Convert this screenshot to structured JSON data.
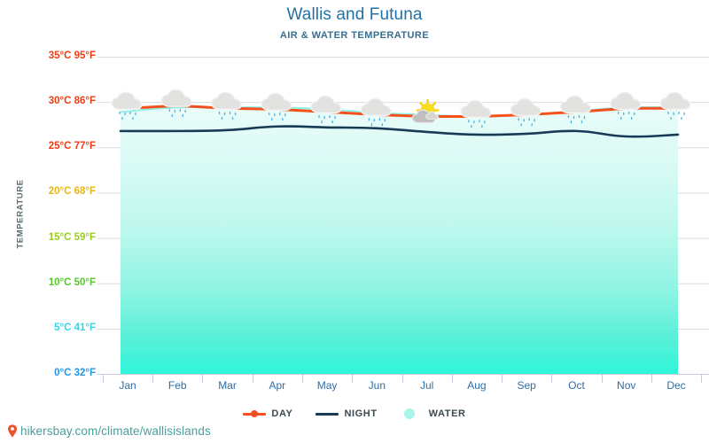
{
  "header": {
    "title": "Wallis and Futuna",
    "subtitle": "AIR & WATER TEMPERATURE"
  },
  "axis": {
    "y_title": "TEMPERATURE"
  },
  "legend": {
    "items": [
      {
        "label": "DAY",
        "type": "line-marker",
        "color": "#F4511E"
      },
      {
        "label": "NIGHT",
        "type": "line",
        "color": "#173A56"
      },
      {
        "label": "WATER",
        "type": "circle",
        "color": "#A8F5EA"
      }
    ]
  },
  "footer": {
    "icon": "map-pin-icon",
    "text": "hikersbay.com/climate/wallisislands",
    "color": "#4a9e9a",
    "pin_color": "#E8542A"
  },
  "weather_icons": [
    "rain-cloud-icon",
    "rain-cloud-icon",
    "rain-cloud-icon",
    "rain-cloud-icon",
    "rain-cloud-icon",
    "rain-cloud-icon",
    "sun-behind-cloud-icon",
    "rain-cloud-icon",
    "rain-cloud-icon",
    "rain-cloud-icon",
    "rain-cloud-icon",
    "rain-cloud-icon"
  ],
  "chart_data": {
    "type": "line",
    "title": "Wallis and Futuna",
    "subtitle": "AIR & WATER TEMPERATURE",
    "xlabel": "",
    "ylabel": "TEMPERATURE",
    "categories": [
      "Jan",
      "Feb",
      "Mar",
      "Apr",
      "May",
      "Jun",
      "Jul",
      "Aug",
      "Sep",
      "Oct",
      "Nov",
      "Dec"
    ],
    "ylim": [
      0,
      35
    ],
    "yticks": [
      0,
      5,
      10,
      15,
      20,
      25,
      30,
      35
    ],
    "ytick_labels": [
      "0°C 32°F",
      "5°C 41°F",
      "10°C 50°F",
      "15°C 59°F",
      "20°C 68°F",
      "25°C 77°F",
      "30°C 86°F",
      "35°C 95°F"
    ],
    "ytick_colors": [
      "#2196E3",
      "#35D6E6",
      "#55C82A",
      "#9ACD1E",
      "#E8B711",
      "#F03C11",
      "#F03C11",
      "#F03C11"
    ],
    "grid": true,
    "legend_position": "bottom",
    "series": [
      {
        "name": "DAY",
        "color": "#F4511E",
        "values": [
          29.3,
          29.6,
          29.3,
          29.2,
          28.9,
          28.6,
          28.4,
          28.4,
          28.6,
          28.9,
          29.3,
          29.3
        ]
      },
      {
        "name": "NIGHT",
        "color": "#173A56",
        "values": [
          26.8,
          26.8,
          26.9,
          27.3,
          27.2,
          27.1,
          26.7,
          26.4,
          26.5,
          26.8,
          26.2,
          26.4
        ]
      },
      {
        "name": "WATER",
        "color": "#8FF0E4",
        "fill": true,
        "values": [
          28.9,
          29.4,
          29.4,
          29.4,
          29.2,
          28.8,
          28.6,
          28.4,
          28.6,
          29.0,
          29.4,
          29.4
        ]
      }
    ]
  }
}
